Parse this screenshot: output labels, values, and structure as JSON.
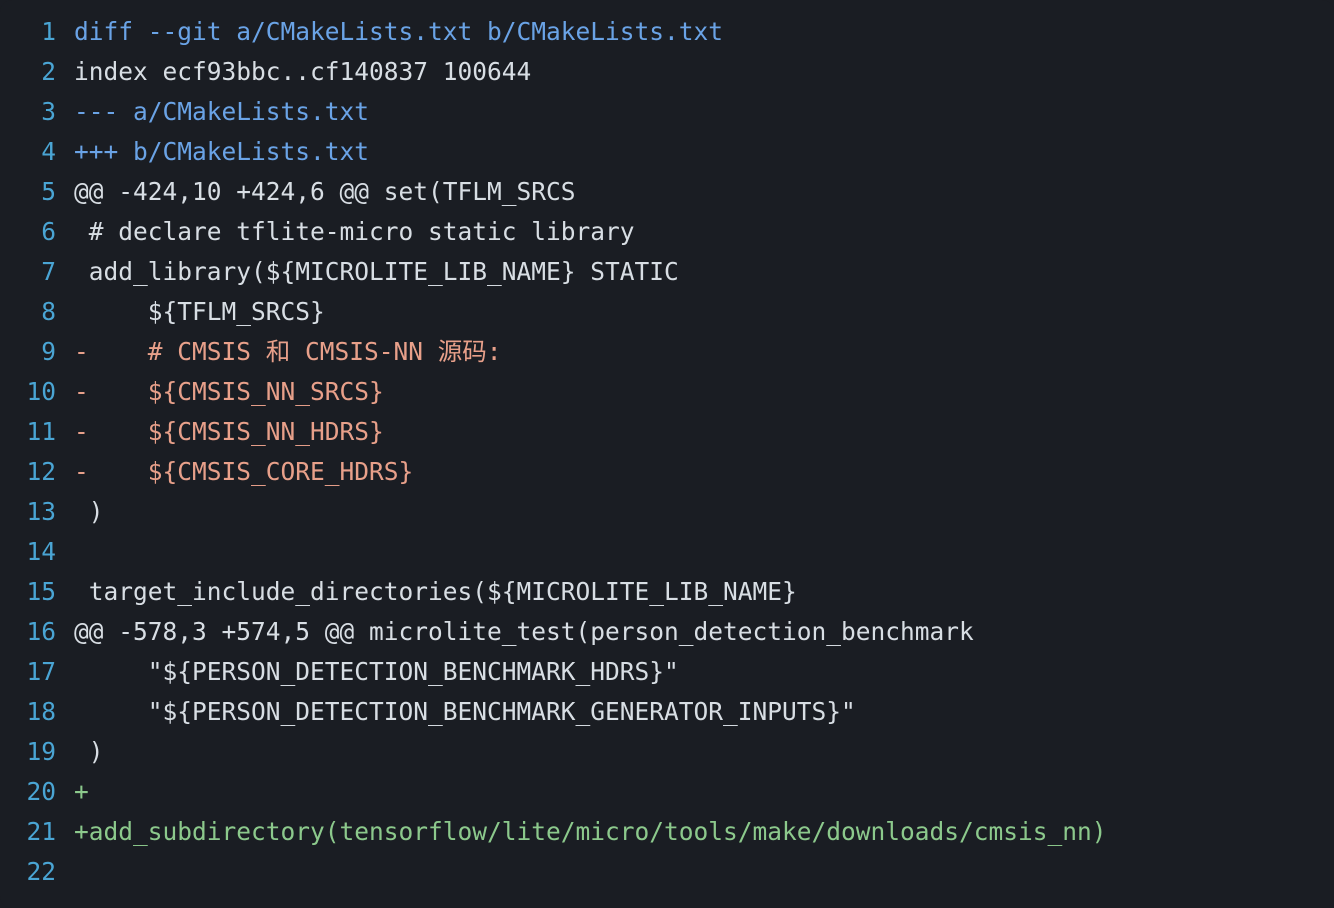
{
  "editor": {
    "theme": {
      "background": "#1a1d23",
      "gutter_color": "#4aa5d4",
      "default_color": "#d8dee4",
      "header_color": "#6aa3e6",
      "removed_color": "#e8a08a",
      "added_color": "#8cc98c"
    },
    "lines": [
      {
        "n": 1,
        "kind": "header",
        "text": "diff --git a/CMakeLists.txt b/CMakeLists.txt"
      },
      {
        "n": 2,
        "kind": "default",
        "text": "index ecf93bbc..cf140837 100644"
      },
      {
        "n": 3,
        "kind": "header",
        "text": "--- a/CMakeLists.txt"
      },
      {
        "n": 4,
        "kind": "header",
        "text": "+++ b/CMakeLists.txt"
      },
      {
        "n": 5,
        "kind": "default",
        "text": "@@ -424,10 +424,6 @@ set(TFLM_SRCS"
      },
      {
        "n": 6,
        "kind": "default",
        "text": " # declare tflite-micro static library"
      },
      {
        "n": 7,
        "kind": "default",
        "text": " add_library(${MICROLITE_LIB_NAME} STATIC"
      },
      {
        "n": 8,
        "kind": "default",
        "text": "     ${TFLM_SRCS}"
      },
      {
        "n": 9,
        "kind": "removed",
        "text": "-    # CMSIS 和 CMSIS-NN 源码:"
      },
      {
        "n": 10,
        "kind": "removed",
        "text": "-    ${CMSIS_NN_SRCS}"
      },
      {
        "n": 11,
        "kind": "removed",
        "text": "-    ${CMSIS_NN_HDRS}"
      },
      {
        "n": 12,
        "kind": "removed",
        "text": "-    ${CMSIS_CORE_HDRS}"
      },
      {
        "n": 13,
        "kind": "default",
        "text": " )"
      },
      {
        "n": 14,
        "kind": "default",
        "text": ""
      },
      {
        "n": 15,
        "kind": "default",
        "text": " target_include_directories(${MICROLITE_LIB_NAME}"
      },
      {
        "n": 16,
        "kind": "default",
        "text": "@@ -578,3 +574,5 @@ microlite_test(person_detection_benchmark"
      },
      {
        "n": 17,
        "kind": "default",
        "text": "     \"${PERSON_DETECTION_BENCHMARK_HDRS}\""
      },
      {
        "n": 18,
        "kind": "default",
        "text": "     \"${PERSON_DETECTION_BENCHMARK_GENERATOR_INPUTS}\""
      },
      {
        "n": 19,
        "kind": "default",
        "text": " )"
      },
      {
        "n": 20,
        "kind": "added",
        "text": "+"
      },
      {
        "n": 21,
        "kind": "added",
        "text": "+add_subdirectory(tensorflow/lite/micro/tools/make/downloads/cmsis_nn)"
      },
      {
        "n": 22,
        "kind": "default",
        "text": ""
      }
    ]
  }
}
